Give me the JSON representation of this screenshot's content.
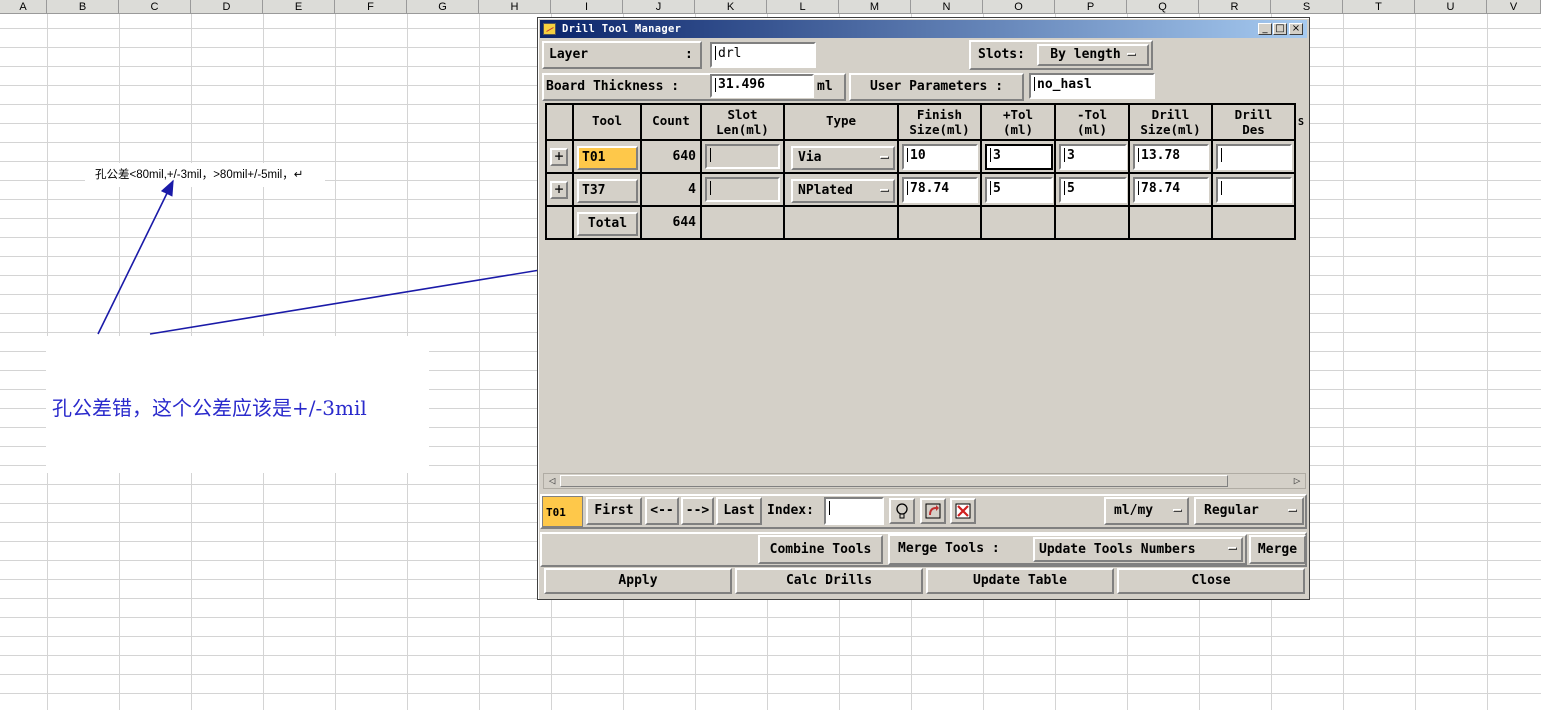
{
  "spreadsheet": {
    "columns": [
      "A",
      "B",
      "C",
      "D",
      "E",
      "F",
      "G",
      "H",
      "I",
      "J",
      "K",
      "L",
      "M",
      "N",
      "O",
      "P",
      "Q",
      "R",
      "S",
      "T",
      "U",
      "V"
    ],
    "note_small": "孔公差<80mil,+/-3mil，>80mil+/-5mil，↵",
    "note_big": "孔公差错，这个公差应该是+/-3mil"
  },
  "dialog": {
    "title": "Drill Tool Manager",
    "layer_label": "Layer",
    "layer_colon": ":",
    "layer_value": "drl",
    "slots_label": "Slots:",
    "slots_value": "By length",
    "board_thickness_label": "Board Thickness :",
    "board_thickness_value": "31.496",
    "board_thickness_unit": "ml",
    "user_params_label": "User Parameters :",
    "user_params_value": "no_hasl",
    "table": {
      "headers": {
        "tool": "Tool",
        "count": "Count",
        "slot_len_1": "Slot",
        "slot_len_2": "Len(ml)",
        "type": "Type",
        "finish_1": "Finish",
        "finish_2": "Size(ml)",
        "ptol_1": "+Tol",
        "ptol_2": "(ml)",
        "ntol_1": "-Tol",
        "ntol_2": "(ml)",
        "drill_1": "Drill",
        "drill_2": "Size(ml)",
        "des_1": "Drill",
        "des_2": "Des",
        "extra": "S"
      },
      "rows": [
        {
          "tool": "T01",
          "count": "640",
          "slot_len": "",
          "type": "Via",
          "finish": "10",
          "ptol": "3",
          "ntol": "3",
          "drill": "13.78",
          "des": ""
        },
        {
          "tool": "T37",
          "count": "4",
          "slot_len": "",
          "type": "NPlated",
          "finish": "78.74",
          "ptol": "5",
          "ntol": "5",
          "drill": "78.74",
          "des": ""
        }
      ],
      "total_label": "Total",
      "total_count": "644"
    },
    "nav": {
      "current_tool": "T01",
      "first": "First",
      "prev": "<--",
      "next": "-->",
      "last": "Last",
      "index_label": "Index:",
      "index_value": "",
      "units_value": "ml/my",
      "mode_value": "Regular"
    },
    "actions": {
      "combine": "Combine Tools",
      "merge_label": "Merge Tools :",
      "update_numbers": "Update Tools Numbers",
      "merge": "Merge",
      "apply": "Apply",
      "calc": "Calc Drills",
      "update_table": "Update Table",
      "close": "Close"
    },
    "colors": {
      "highlight": "#fec84a",
      "title_start": "#0a246a",
      "annotation": "#2a2acc"
    }
  }
}
